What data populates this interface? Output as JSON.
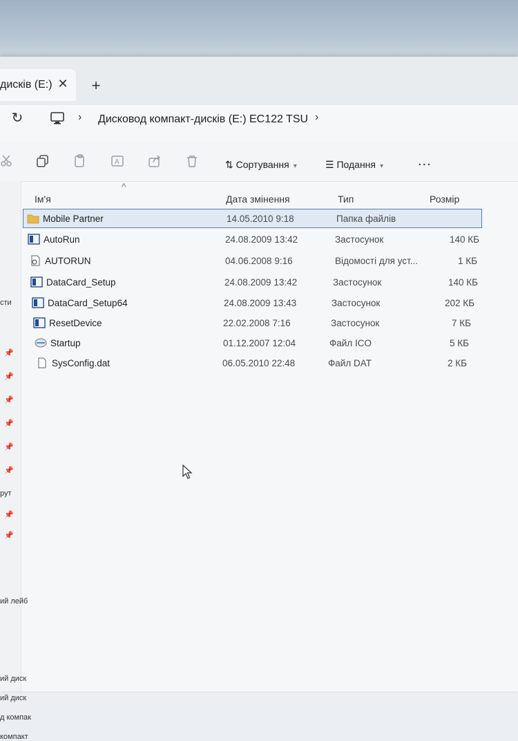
{
  "tab": {
    "label": "дисків (E:)",
    "close_glyph": "✕",
    "new_glyph": "+"
  },
  "address": {
    "breadcrumb": "Дисковод компакт-дисків (E:) EC122 TSU",
    "chevron": "›"
  },
  "toolbar": {
    "sort_label": "Сортування",
    "view_label": "Подання",
    "more_label": "..."
  },
  "columns": {
    "name": "Ім'я",
    "date": "Дата змінення",
    "type": "Тип",
    "size": "Розмір"
  },
  "files": [
    {
      "name": "Mobile Partner",
      "date": "14.05.2010 9:18",
      "type": "Папка файлів",
      "size": "",
      "icon": "folder-icon",
      "selected": true
    },
    {
      "name": "AutoRun",
      "date": "24.08.2009 13:42",
      "type": "Застосунок",
      "size": "140 КБ",
      "icon": "app-icon",
      "selected": false
    },
    {
      "name": "AUTORUN",
      "date": "04.06.2008 9:16",
      "type": "Відомості для уст...",
      "size": "1 КБ",
      "icon": "setup-info-icon",
      "selected": false
    },
    {
      "name": "DataCard_Setup",
      "date": "24.08.2009 13:42",
      "type": "Застосунок",
      "size": "140 КБ",
      "icon": "app-icon",
      "selected": false
    },
    {
      "name": "DataCard_Setup64",
      "date": "24.08.2009 13:43",
      "type": "Застосунок",
      "size": "202 КБ",
      "icon": "app-icon",
      "selected": false
    },
    {
      "name": "ResetDevice",
      "date": "22.02.2008 7:16",
      "type": "Застосунок",
      "size": "7 КБ",
      "icon": "app-icon",
      "selected": false
    },
    {
      "name": "Startup",
      "date": "01.12.2007 12:04",
      "type": "Файл ICO",
      "size": "5 КБ",
      "icon": "ico-file-icon",
      "selected": false
    },
    {
      "name": "SysConfig.dat",
      "date": "06.05.2010 22:48",
      "type": "Файл DAT",
      "size": "2 КБ",
      "icon": "document-icon",
      "selected": false
    }
  ],
  "nav": {
    "text_1": "сти",
    "text_2": "рут",
    "text_3": "ий лейб",
    "text_4": "ий диск",
    "text_5": "ий диск",
    "text_6": "д компак",
    "text_7": "компакт"
  },
  "colors": {
    "selection_bg": "#dfe8f3",
    "selection_border": "#5a7ea8",
    "folder": "#e8b84a",
    "app_blue": "#1f4e8c"
  }
}
